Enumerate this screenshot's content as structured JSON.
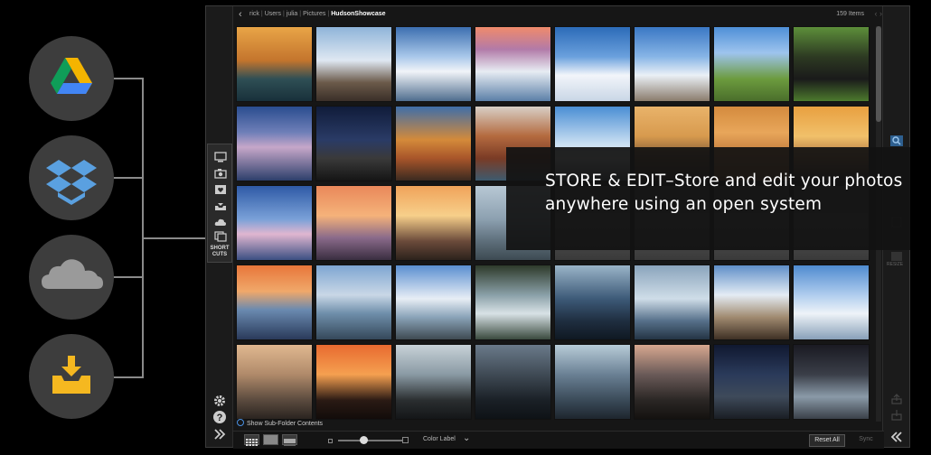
{
  "services": [
    {
      "name": "Google Drive",
      "icon": "google-drive-icon"
    },
    {
      "name": "Dropbox",
      "icon": "dropbox-icon"
    },
    {
      "name": "OneDrive",
      "icon": "onedrive-icon"
    },
    {
      "name": "Local Drive",
      "icon": "drive-tray-icon"
    }
  ],
  "breadcrumb": [
    {
      "label": "rick"
    },
    {
      "label": "Users"
    },
    {
      "label": "julia"
    },
    {
      "label": "Pictures"
    },
    {
      "label": "HudsonShowcase"
    }
  ],
  "item_count": "159 Items",
  "shortcuts": {
    "label_line1": "SHORT",
    "label_line2": "CUTS"
  },
  "right_rail": {
    "resize_label": "RESIZE"
  },
  "status": {
    "show_subfolder": "Show Sub-Folder Contents"
  },
  "toolbar": {
    "color_label": "Color Label",
    "reset_all": "Reset All",
    "sync": "Sync"
  },
  "overlay": {
    "text": "STORE & EDIT–Store and edit your photos anywhere using an open system"
  },
  "colors": {
    "accent_blue": "#4a90e2",
    "panel_bg": "#161616"
  }
}
